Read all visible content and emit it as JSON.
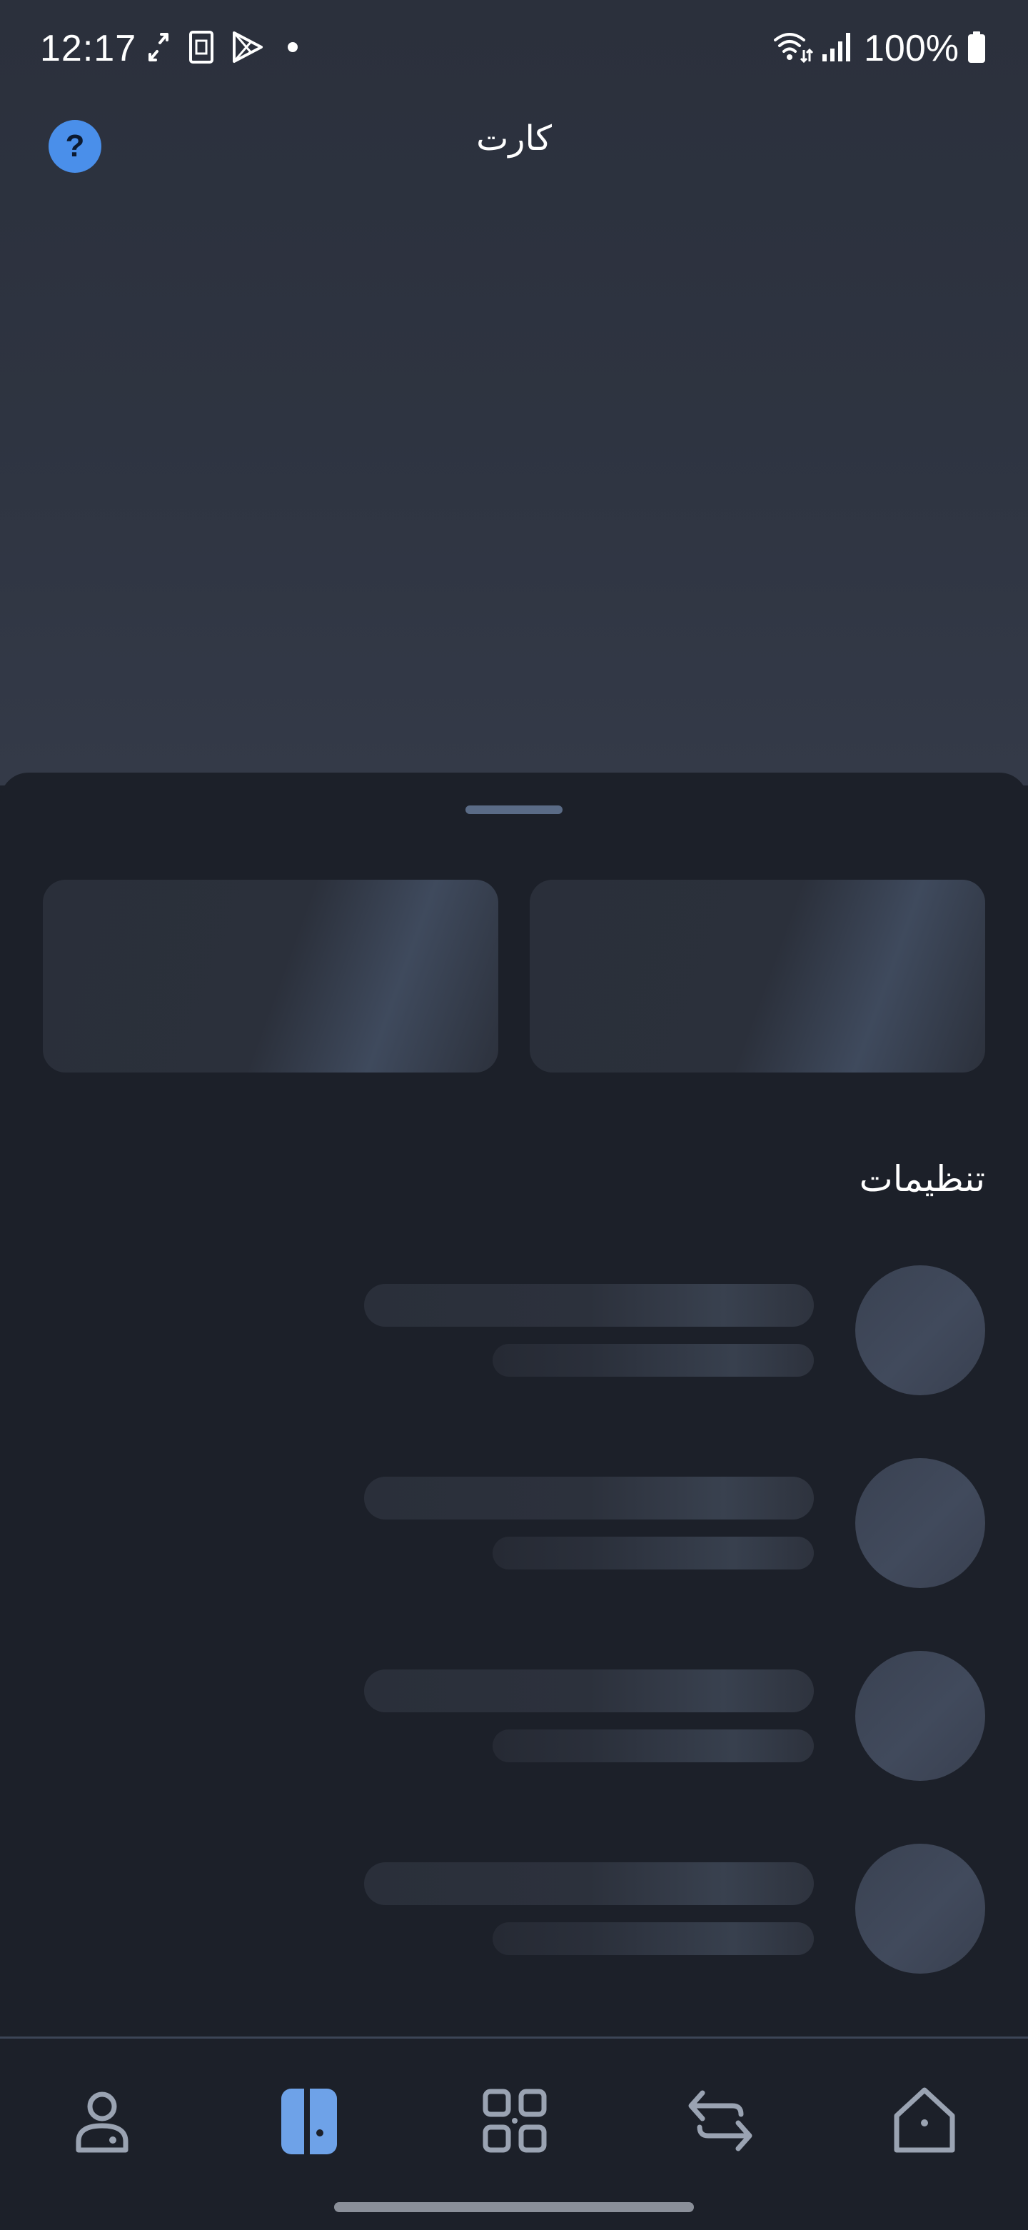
{
  "status_bar": {
    "time": "12:17",
    "battery": "100%"
  },
  "header": {
    "title": "کارت",
    "help_symbol": "?"
  },
  "sheet": {
    "settings_title": "تنظیمات",
    "skeleton_rows": 4
  },
  "nav": {
    "items": [
      {
        "icon": "profile-icon"
      },
      {
        "icon": "card-icon",
        "active": true
      },
      {
        "icon": "apps-grid-icon"
      },
      {
        "icon": "transfer-icon"
      },
      {
        "icon": "home-icon"
      }
    ]
  },
  "colors": {
    "accent": "#4a8fea",
    "active_nav": "#6ea2e8",
    "nav_icon": "#9aa3b2",
    "background": "#1c2029"
  }
}
